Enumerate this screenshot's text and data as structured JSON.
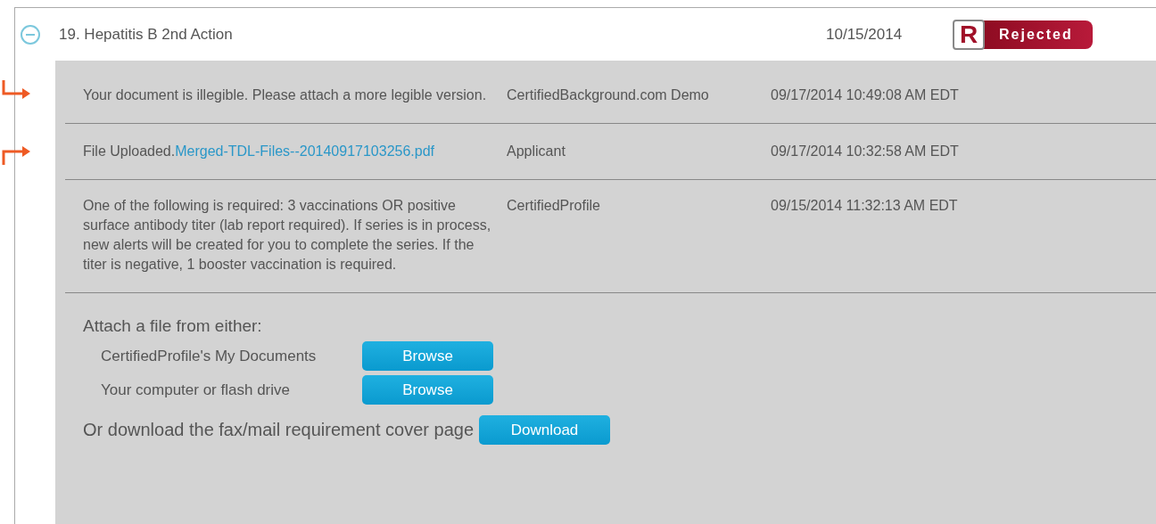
{
  "item": {
    "title": "19. Hepatitis B 2nd Action",
    "date": "10/15/2014",
    "expanded": true,
    "status": {
      "letter": "R",
      "label": "Rejected"
    }
  },
  "entries": [
    {
      "kind": "down",
      "message": "Your document is illegible. Please attach a more legible version.",
      "author": "CertifiedBackground.com Demo",
      "timestamp": "09/17/2014 10:49:08 AM EDT"
    },
    {
      "kind": "up",
      "message": "File Uploaded.",
      "link": "Merged-TDL-Files--20140917103256.pdf",
      "author": "Applicant",
      "timestamp": "09/17/2014 10:32:58 AM EDT"
    },
    {
      "kind": "plain",
      "message": "One of the following is required: 3 vaccinations OR positive surface antibody titer (lab report required). If series is in process, new alerts will be created for you to complete the series. If the titer is negative, 1 booster vaccination is required.",
      "author": "CertifiedProfile",
      "timestamp": "09/15/2014 11:32:13 AM EDT"
    }
  ],
  "attach": {
    "heading": "Attach a file from either:",
    "sources": [
      {
        "label": "CertifiedProfile's My Documents",
        "button": "Browse"
      },
      {
        "label": "Your computer or flash drive",
        "button": "Browse"
      }
    ],
    "download_text": "Or download the fax/mail requirement cover page",
    "download_button": "Download"
  }
}
